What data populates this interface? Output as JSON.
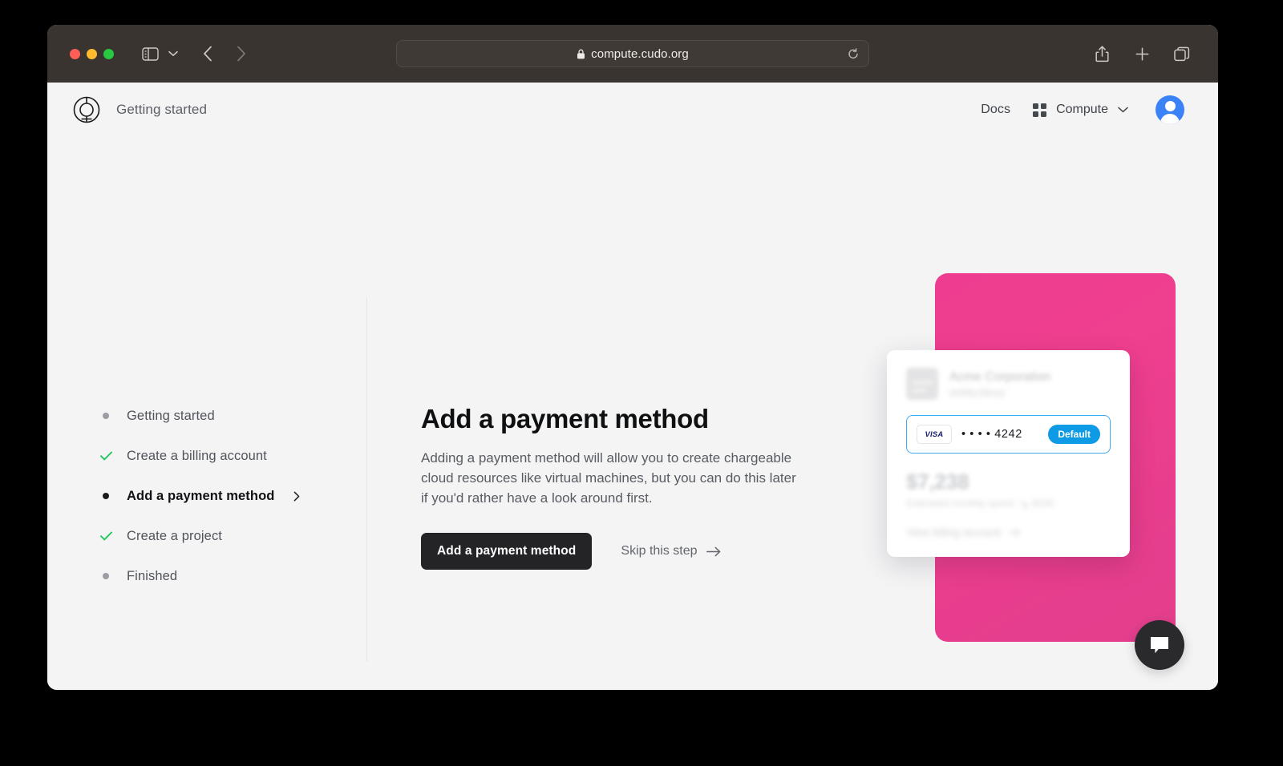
{
  "browser": {
    "url": "compute.cudo.org",
    "lock_icon": "lock-icon",
    "reload_icon": "reload-icon",
    "sidebar_toggle_icon": "sidebar-toggle-icon",
    "sidebar_chevron_icon": "chevron-down-icon",
    "back_icon": "chevron-left-icon",
    "forward_icon": "chevron-right-icon",
    "share_icon": "share-icon",
    "new_tab_icon": "plus-icon",
    "tabs_icon": "tab-overview-icon",
    "traffic_lights": [
      "close",
      "minimize",
      "zoom"
    ]
  },
  "header": {
    "logo_icon": "cudo-logo-icon",
    "title": "Getting started",
    "docs_label": "Docs",
    "product_label": "Compute",
    "product_chevron_icon": "chevron-down-icon",
    "grid_icon": "grid-apps-icon",
    "avatar_icon": "user-avatar-icon"
  },
  "steps": [
    {
      "label": "Getting started",
      "state": "pending",
      "marker": "dot"
    },
    {
      "label": "Create a billing account",
      "state": "complete",
      "marker": "check"
    },
    {
      "label": "Add a payment method",
      "state": "active",
      "marker": "dot",
      "chevron": "chevron-right-icon"
    },
    {
      "label": "Create a project",
      "state": "complete",
      "marker": "check"
    },
    {
      "label": "Finished",
      "state": "pending",
      "marker": "dot"
    }
  ],
  "main": {
    "title": "Add a payment method",
    "description": "Adding a payment method will allow you to create chargeable cloud resources like virtual machines, but you can do this later if you'd rather have a look around first.",
    "primary_cta": "Add a payment method",
    "skip_label": "Skip this step",
    "skip_icon": "arrow-right-icon"
  },
  "illustration": {
    "account_name": "Acme Corporation",
    "account_id": "dx9i6y16luvy",
    "card_brand": "VISA",
    "card_number": "• • • • 4242",
    "default_badge": "Default",
    "spend_amount": "$7,238",
    "spend_caption": "Estimated monthly spend",
    "spend_delta": "$185",
    "spend_delta_icon": "arrow-down-right-icon",
    "view_billing_label": "View billing account",
    "view_billing_icon": "arrow-right-icon"
  },
  "chat": {
    "icon": "chat-bubble-icon"
  },
  "colors": {
    "accent_pink": "#ee3d91",
    "accent_blue": "#0f9ae6",
    "focus_blue": "#3fa9f5",
    "success_green": "#22c55e",
    "cta_dark": "#242426",
    "page_bg": "#f4f4f5",
    "chrome_bg": "#3a3431"
  }
}
